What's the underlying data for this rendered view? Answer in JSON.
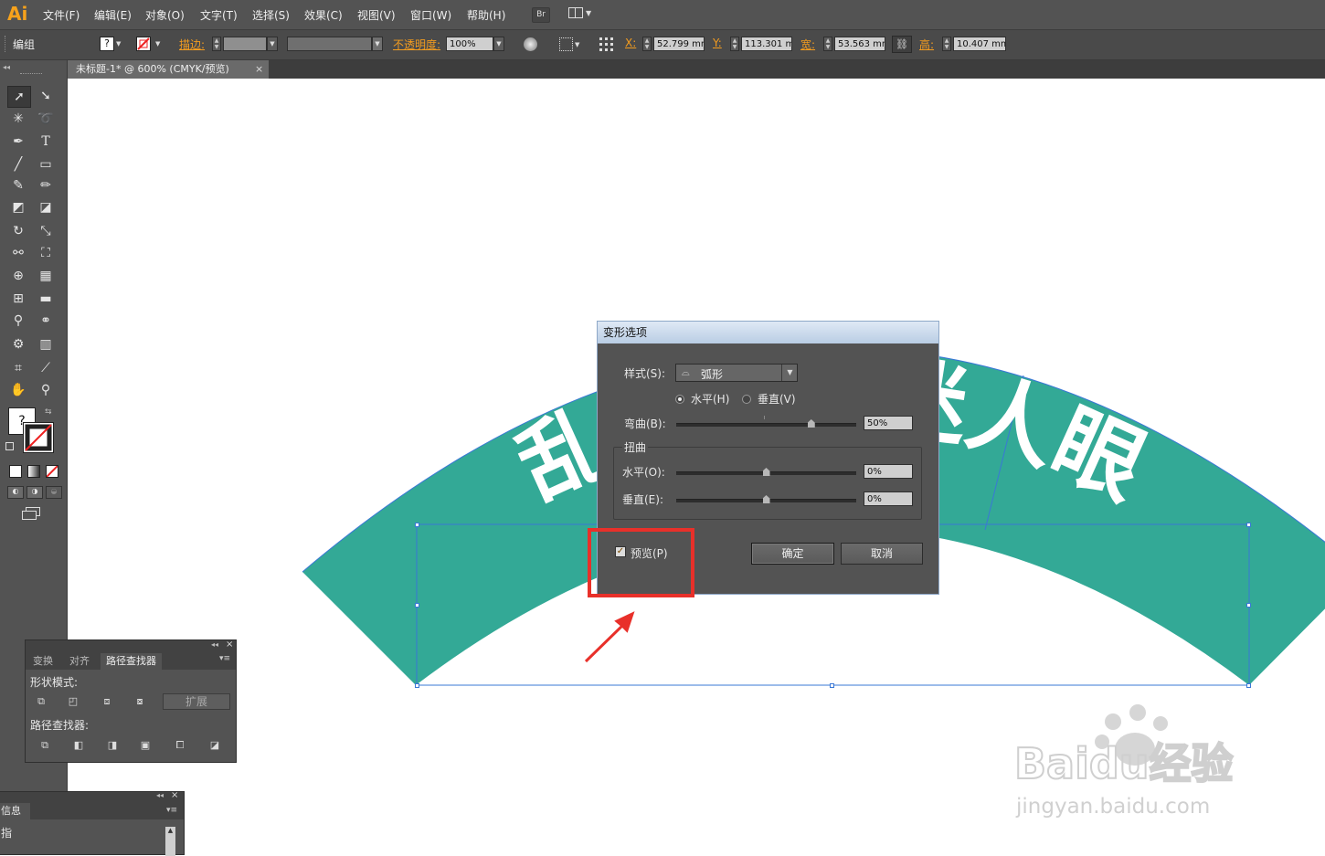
{
  "app": {
    "logo": "Ai"
  },
  "menu": [
    "文件(F)",
    "编辑(E)",
    "对象(O)",
    "文字(T)",
    "选择(S)",
    "效果(C)",
    "视图(V)",
    "窗口(W)",
    "帮助(H)"
  ],
  "bridge_label": "Br",
  "control_bar": {
    "selection": "编组",
    "fill_value": "?",
    "stroke_label": "描边:",
    "opacity_label": "不透明度:",
    "opacity_value": "100%",
    "x_label": "X:",
    "x_value": "52.799 mm",
    "y_label": "Y:",
    "y_value": "113.301 mm",
    "w_label": "宽:",
    "w_value": "53.563 mm",
    "h_label": "高:",
    "h_value": "10.407 mm"
  },
  "document_tab": {
    "title": "未标题-1* @ 600% (CMYK/预览)",
    "close": "×"
  },
  "toolbox": {
    "fill_value": "?"
  },
  "artwork": {
    "text": "乱花渐欲迷人眼",
    "fill_color": "#33a996",
    "text_color": "#ffffff",
    "selection_color": "#3a78d6"
  },
  "pathfinder_panel": {
    "tabs": [
      "变换",
      "对齐",
      "路径查找器"
    ],
    "shape_modes_label": "形状模式:",
    "expand_button": "扩展",
    "pathfinders_label": "路径查找器:"
  },
  "info_panel": {
    "tab": "信息",
    "row": "指"
  },
  "dialog": {
    "title": "变形选项",
    "style_label": "样式(S):",
    "style_value": "弧形",
    "horizontal_label": "水平(H)",
    "vertical_label": "垂直(V)",
    "orientation_selected": "horizontal",
    "bend_label": "弯曲(B):",
    "bend_value": "50%",
    "bend_fraction": 0.75,
    "distortion_label": "扭曲",
    "distort_h_label": "水平(O):",
    "distort_h_value": "0%",
    "distort_h_fraction": 0.5,
    "distort_v_label": "垂直(E):",
    "distort_v_value": "0%",
    "distort_v_fraction": 0.5,
    "preview_label": "预览(P)",
    "preview_checked": true,
    "ok_button": "确定",
    "cancel_button": "取消"
  },
  "annotation": {
    "highlight_color": "#e8302a"
  },
  "watermark": {
    "brand": "Baidu经验",
    "url": "jingyan.baidu.com"
  }
}
